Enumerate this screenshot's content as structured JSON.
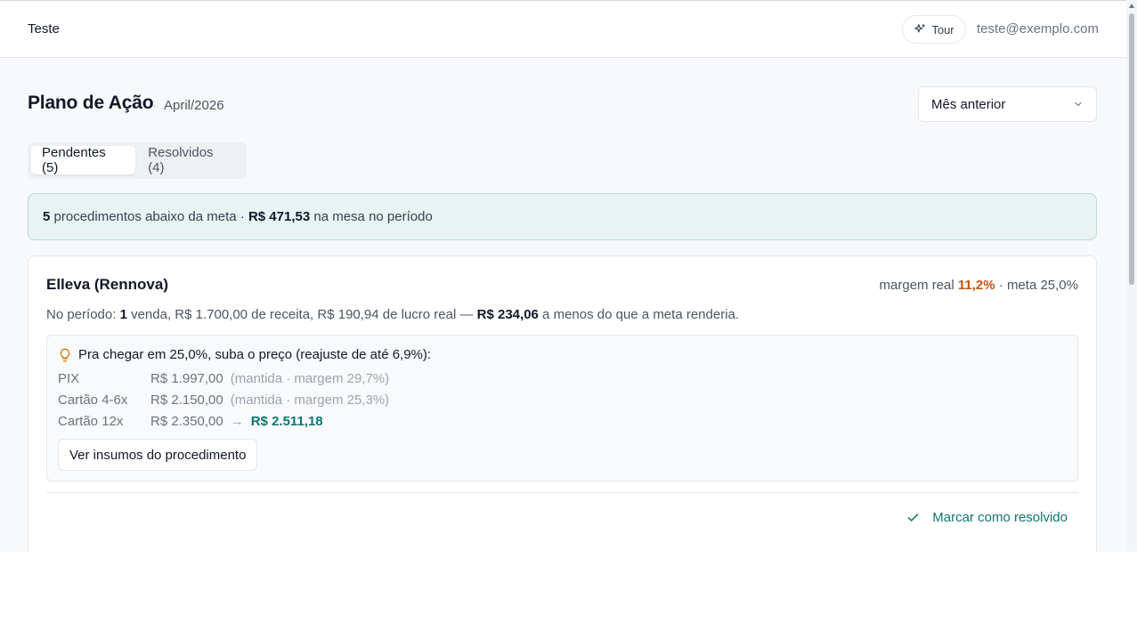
{
  "header": {
    "brand": "Teste",
    "tour_label": "Tour",
    "user_email": "teste@exemplo.com"
  },
  "page": {
    "title": "Plano de Ação",
    "period": "April/2026",
    "period_select": "Mês anterior"
  },
  "tabs": [
    {
      "label": "Pendentes (5)",
      "active": true
    },
    {
      "label": "Resolvidos (4)",
      "active": false
    }
  ],
  "summary": {
    "count": "5",
    "text1": " procedimentos abaixo da meta · ",
    "amount": "R$ 471,53",
    "text2": " na mesa no período"
  },
  "card": {
    "title": "Elleva (Rennova)",
    "margin_prefix": "margem real ",
    "margin_real": "11,2%",
    "margin_suffix": " · meta 25,0%",
    "desc_prefix": "No período: ",
    "desc_sales": "1",
    "desc_mid": " venda, R$ 1.700,00 de receita, R$ 190,94 de lucro real — ",
    "desc_amount": "R$ 234,06",
    "desc_suffix": " a menos do que a meta renderia.",
    "suggestion_title": "Pra chegar em 25,0%, suba o preço (reajuste de até 6,9%):",
    "prices": [
      {
        "label": "PIX",
        "value": "R$ 1.997,00",
        "note": "(mantida · margem 29,7%)"
      },
      {
        "label": "Cartão 4-6x",
        "value": "R$ 2.150,00",
        "note": "(mantida · margem 25,3%)"
      },
      {
        "label": "Cartão 12x",
        "value": "R$ 2.350,00",
        "arrow": "→",
        "new_value": "R$ 2.511,18"
      }
    ],
    "insumos_button": "Ver insumos do procedimento",
    "resolve_button": "Marcar como resolvido"
  },
  "colors": {
    "accent_teal": "#0f766e",
    "margin_warning": "#c2570c",
    "summary_bg": "#e9f3f3"
  },
  "icons": [
    "sparkles-icon",
    "chevron-down-icon",
    "lightbulb-icon",
    "check-icon"
  ]
}
